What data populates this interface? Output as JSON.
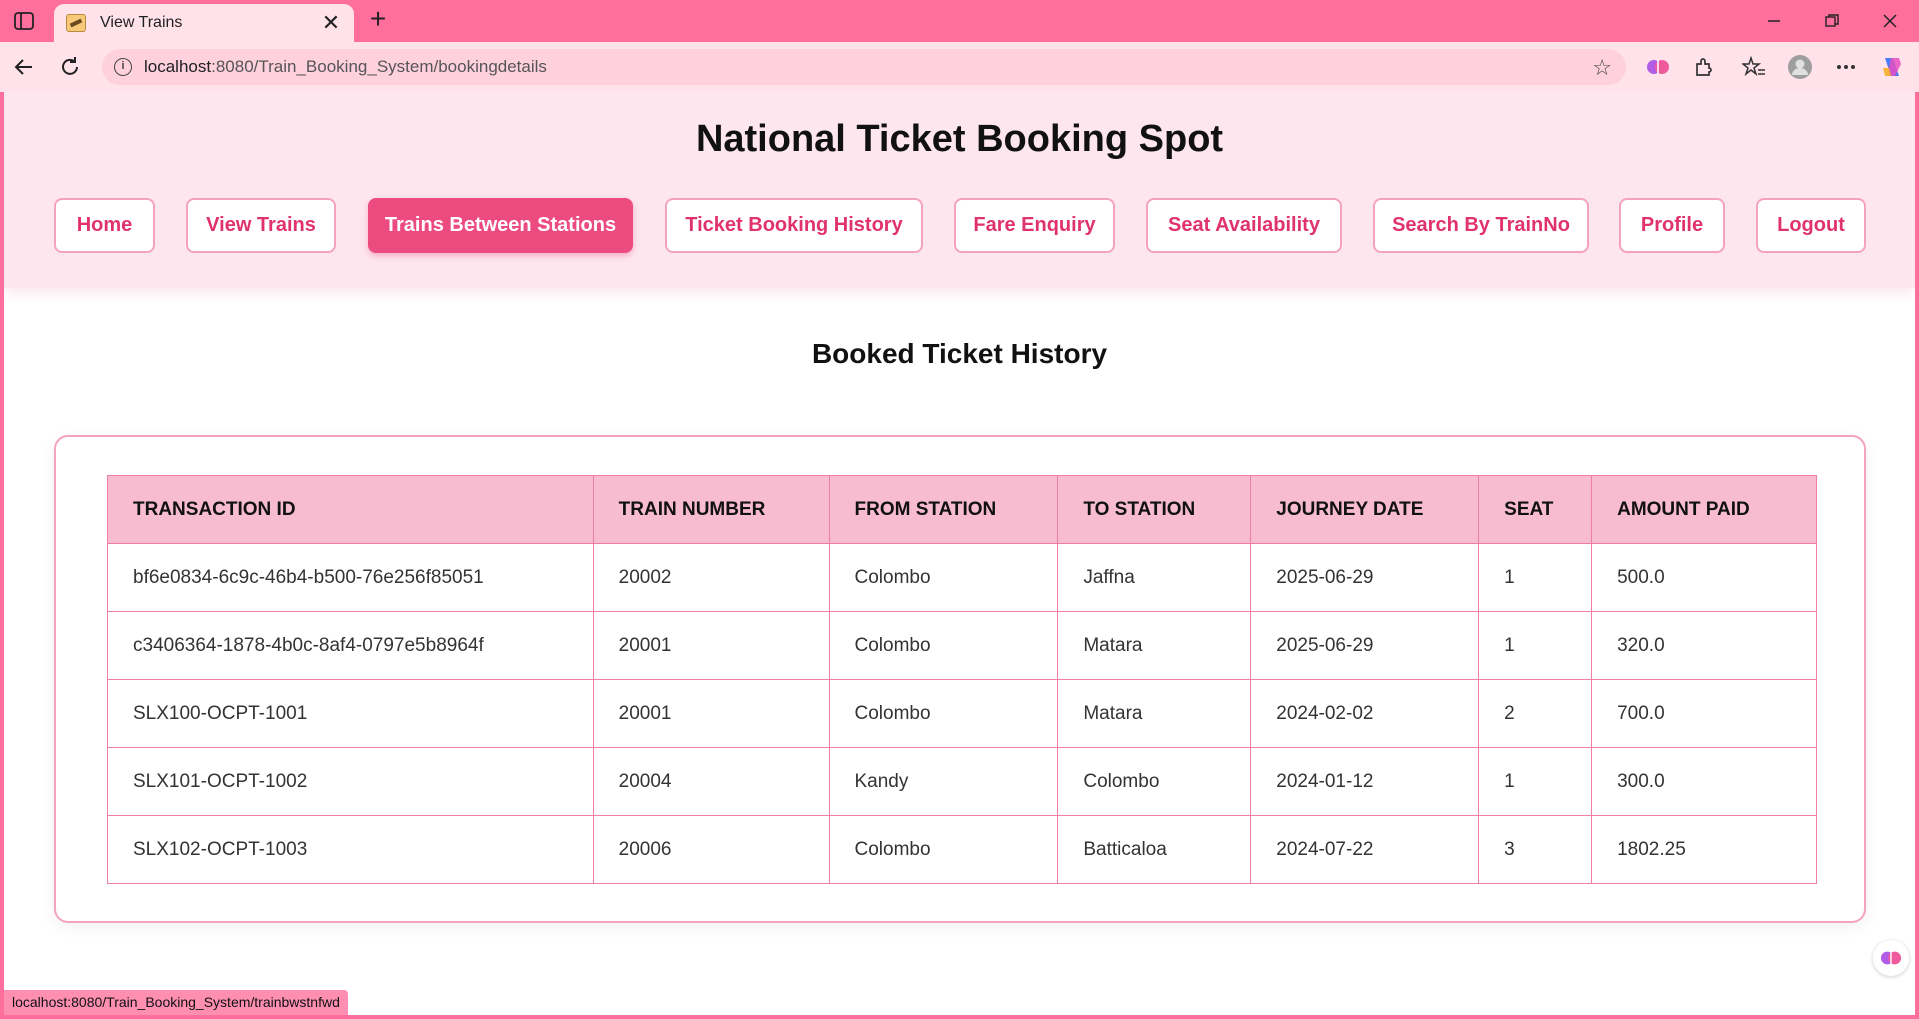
{
  "browser": {
    "tab_title": "View Trains",
    "tab_close": "✕",
    "new_tab": "+",
    "url_host": "localhost",
    "url_rest": ":8080/Train_Booking_System/bookingdetails",
    "status_url": "localhost:8080/Train_Booking_System/trainbwstnfwd",
    "icons": [
      "sidebar-toggle-icon",
      "back-icon",
      "refresh-icon",
      "info-icon",
      "favorite-star-icon",
      "copilot-brain-icon",
      "extensions-icon",
      "favorites-icon",
      "profile-icon",
      "more-icon",
      "copilot-icon",
      "minimize-icon",
      "restore-icon",
      "close-icon"
    ]
  },
  "site": {
    "title": "National Ticket Booking Spot",
    "menu": [
      {
        "label": "Home"
      },
      {
        "label": "View Trains"
      },
      {
        "label": "Trains Between Stations",
        "active": true
      },
      {
        "label": "Ticket Booking History"
      },
      {
        "label": "Fare Enquiry"
      },
      {
        "label": "Seat Availability"
      },
      {
        "label": "Search By TrainNo"
      },
      {
        "label": "Profile"
      },
      {
        "label": "Logout"
      }
    ],
    "accent_color": "#ec4b80",
    "header_bg": "#fde6ee"
  },
  "history": {
    "title": "Booked Ticket History",
    "columns": [
      "TRANSACTION ID",
      "TRAIN NUMBER",
      "FROM STATION",
      "TO STATION",
      "JOURNEY DATE",
      "SEAT",
      "AMOUNT PAID"
    ],
    "rows": [
      [
        "bf6e0834-6c9c-46b4-b500-76e256f85051",
        "20002",
        "Colombo",
        "Jaffna",
        "2025-06-29",
        "1",
        "500.0"
      ],
      [
        "c3406364-1878-4b0c-8af4-0797e5b8964f",
        "20001",
        "Colombo",
        "Matara",
        "2025-06-29",
        "1",
        "320.0"
      ],
      [
        "SLX100-OCPT-1001",
        "20001",
        "Colombo",
        "Matara",
        "2024-02-02",
        "2",
        "700.0"
      ],
      [
        "SLX101-OCPT-1002",
        "20004",
        "Kandy",
        "Colombo",
        "2024-01-12",
        "1",
        "300.0"
      ],
      [
        "SLX102-OCPT-1003",
        "20006",
        "Colombo",
        "Batticaloa",
        "2024-07-22",
        "3",
        "1802.25"
      ]
    ]
  }
}
